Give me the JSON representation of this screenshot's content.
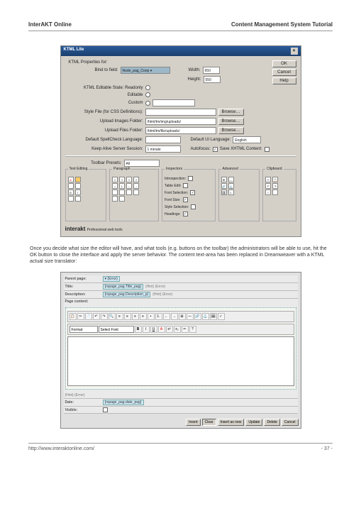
{
  "header": {
    "left": "InterAKT Online",
    "right": "Content Management System Tutorial"
  },
  "footer": {
    "left": "http://www.interaktonline.com/",
    "right": "- 37 -"
  },
  "dialog": {
    "title": "KTML Lite",
    "close": "×",
    "proplabel": "KTML Properties for:",
    "bindlabel": "Bind to field:",
    "bindvalue": "Node_pag_Conp ▾",
    "widthlabel": "Width:",
    "widthval": "650",
    "heightlabel": "Height:",
    "heightval": "550",
    "statelbl": "KTML Editable State: Readonly",
    "editablelbl": "Editable",
    "customlbl": "Custom",
    "stylefilelbl": "Style File (for CSS Definitions):",
    "stylebrowse": "Browse…",
    "uploadimglbl": "Upload Images Folder:",
    "uploadimgval": "/html/tm/img/uploads/",
    "uploadfilelbl": "Upload Files Folder:",
    "uploadfileval": "/html/tm/file/uploads/",
    "spelllbl": "Default SpellCheck Language:",
    "uilbl": "Default UI Language:",
    "uival": "English",
    "keepalivelbl": "Keep Alive Server Session:",
    "keepaliveval": "1 minute",
    "autofocuslbl": "Autofocus:",
    "savelbl": "Save XHTML Content:",
    "toolbarlbl": "Toolbar Presets:",
    "toolbarval": "All",
    "panels": {
      "textediting": "Text Editing",
      "paragraph": "Paragraph",
      "inspectors": "Inspectors",
      "advanced": "Advanced",
      "clipboard": "Clipboard",
      "insp": {
        "i1": "Introspection:",
        "i2": "Table Edit:",
        "i3": "Font Selection:",
        "i4": "Font Size:",
        "i5": "Style Selection:",
        "i6": "Headings:"
      }
    },
    "logo": "interakt",
    "tagline": "Professional web tools",
    "btns": {
      "ok": "OK",
      "cancel": "Cancel",
      "help": "Help"
    }
  },
  "para": "Once you decide what size the editor will have, and what tools (e.g. buttons on the toolbar) the administrators will be able to use, hit the OK button to close the interface and apply the server behavior. The content text-area has been replaced in Dreamweaver with a KTML actual size translator:",
  "editor": {
    "fields": {
      "parent": "Parent page:",
      "parentv": "▾ (Error)",
      "title": "Title:",
      "titlev": "{rspage_pag.Title_pag}",
      "titleh": "(Hint) (Error)",
      "desc": "Description:",
      "descv": "{rspage_pag.Description_p}",
      "desch": "(Hint) (Error)",
      "content": "Page content:",
      "date": "Date:",
      "datev": "{rspage_pag.date_pag}",
      "visible": "Visible:",
      "hint": "(Hint) (Error)"
    },
    "format": "Format",
    "font": "Select Font",
    "btns": {
      "insert": "Insert",
      "clear": "Clear",
      "insnew": "Insert as new",
      "update": "Update",
      "delete": "Delete",
      "cancel": "Cancel"
    }
  }
}
